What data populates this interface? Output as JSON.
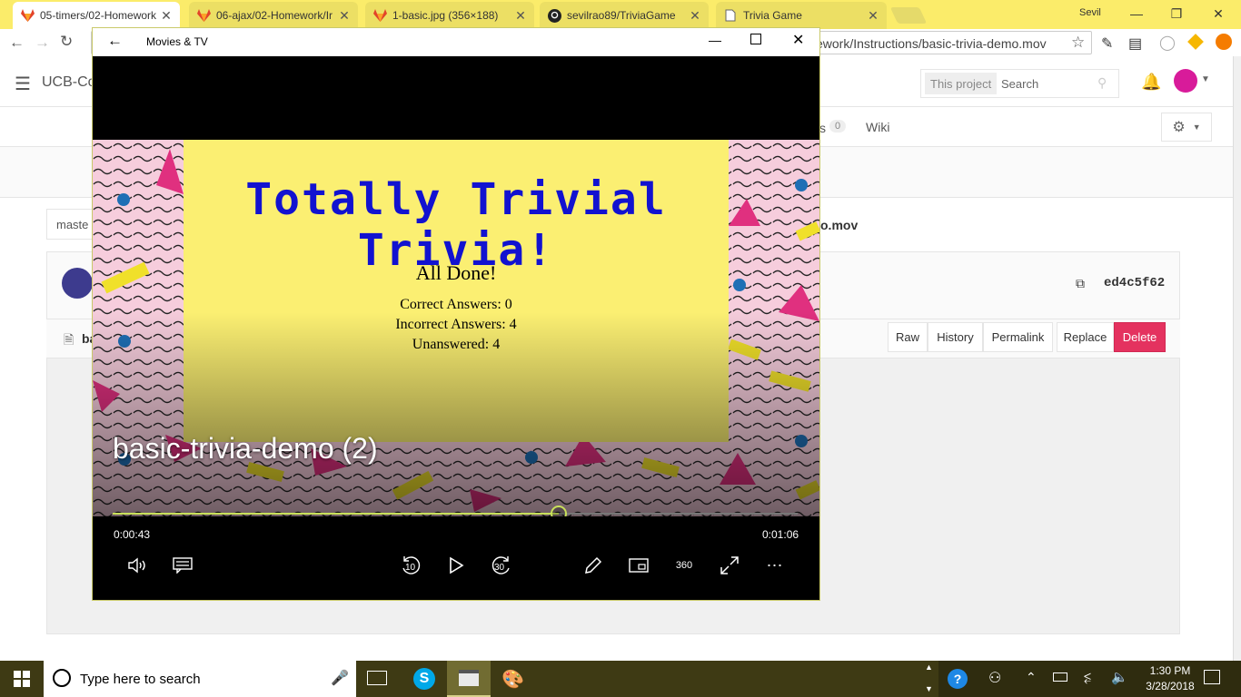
{
  "browser": {
    "tabs": [
      {
        "title": "05-timers/02-Homework",
        "icon": "gitlab-icon",
        "active": true
      },
      {
        "title": "06-ajax/02-Homework/Ir",
        "icon": "gitlab-icon"
      },
      {
        "title": "1-basic.jpg (356×188)",
        "icon": "gitlab-icon"
      },
      {
        "title": "sevilrao89/TriviaGame",
        "icon": "github-icon"
      },
      {
        "title": "Trivia Game",
        "icon": "page-icon"
      }
    ],
    "profile_name": "Sevil",
    "url_visible": "ework/Instructions/basic-trivia-demo.mov"
  },
  "gitlab": {
    "brand": "UCB-Co",
    "search_scope": "This project",
    "search_placeholder": "Search",
    "nav_badge": "0",
    "nav_wiki": "Wiki",
    "nav_partial": "s",
    "branch": "maste",
    "file_path_tail": "o.mov",
    "commit_sha": "ed4c5f62",
    "file_name_partial": "ba",
    "buttons": {
      "raw": "Raw",
      "history": "History",
      "permalink": "Permalink",
      "replace": "Replace",
      "delete": "Delete"
    }
  },
  "player": {
    "app_title": "Movies & TV",
    "video_title": "basic-trivia-demo (2)",
    "elapsed": "0:00:43",
    "duration": "0:01:06",
    "progress": 0.6515,
    "skip_back": "10",
    "skip_fwd": "30",
    "deg360": "360"
  },
  "trivia": {
    "heading": "Totally Trivial Trivia!",
    "done": "All Done!",
    "correct": "Correct Answers: 0",
    "incorrect": "Incorrect Answers: 4",
    "unanswered": "Unanswered: 4"
  },
  "taskbar": {
    "search_placeholder": "Type here to search",
    "time": "1:30 PM",
    "date": "3/28/2018"
  },
  "colors": {
    "accent_yellow": "#fbec6a",
    "delete_red": "#e4325f",
    "trivia_blue": "#1212d0",
    "progress": "#c8e05a"
  }
}
